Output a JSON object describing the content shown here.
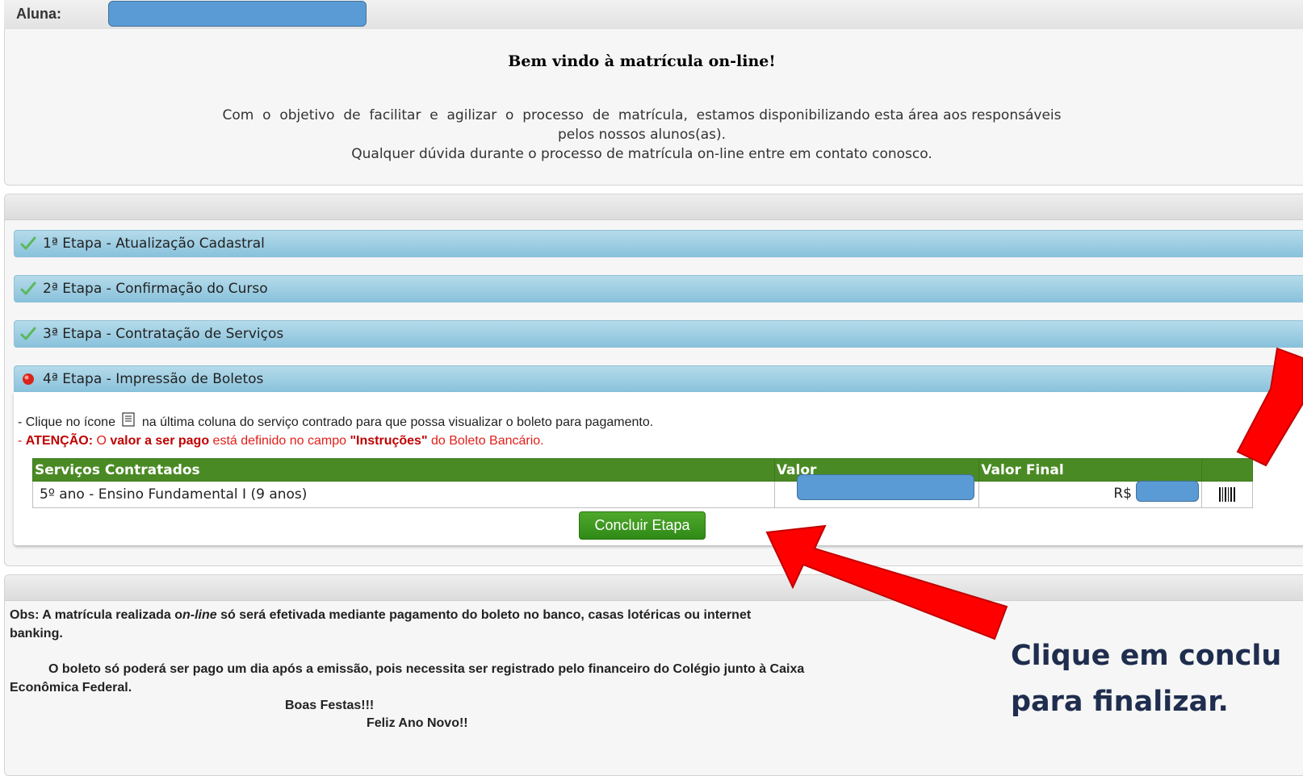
{
  "aluna": {
    "label": "Aluna:",
    "value": ""
  },
  "welcome": {
    "title": "Bem vindo à matrícula on-line!",
    "line1": "Com  o  objetivo  de  facilitar  e  agilizar  o  processo  de  matrícula,  estamos disponibilizando esta área aos responsáveis",
    "line2": "pelos nossos alunos(as).",
    "line3": "Qualquer dúvida durante o processo de matrícula on-line entre em contato conosco."
  },
  "steps": [
    {
      "label": "1ª Etapa - Atualização Cadastral",
      "status": "done",
      "icon": "check-icon"
    },
    {
      "label": "2ª Etapa - Confirmação do Curso",
      "status": "done",
      "icon": "check-icon"
    },
    {
      "label": "3ª Etapa - Contratação de Serviços",
      "status": "done",
      "icon": "check-icon"
    },
    {
      "label": "4ª Etapa - Impressão de Boletos",
      "status": "current",
      "icon": "red-dot-icon"
    }
  ],
  "step4": {
    "instruction_pre": "- Clique no ícone",
    "instruction_post": "na última coluna do serviço contrado para que possa visualizar o boleto para pagamento.",
    "attention_prefix": "- ",
    "attention_label": "ATENÇÃO:",
    "attention_text1": " O ",
    "attention_bold1": "valor a ser pago",
    "attention_text2": " está definido no campo ",
    "attention_bold2": "\"Instruções\"",
    "attention_text3": " do Boleto Bancário.",
    "table": {
      "headers": [
        "Serviços Contratados",
        "Valor",
        "Valor Final",
        ""
      ],
      "rows": [
        {
          "service": "5º ano - Ensino Fundamental I (9 anos)",
          "valor": "",
          "currency": "R$",
          "valor_final": "",
          "action_icon": "barcode-icon"
        }
      ]
    },
    "button_label": "Concluir Etapa"
  },
  "obs": {
    "line1_pre": "Obs: A matrícula realizada o",
    "line1_italic": "n-line",
    "line1_post": " só será efetivada mediante pagamento do boleto no banco, casas lotéricas ou internet",
    "line2": "banking.",
    "line3": "O boleto só poderá ser pago um dia após a emissão, pois necessita ser registrado pelo financeiro do Colégio junto à Caixa",
    "line4": "Econômica Federal.",
    "line5": "Boas Festas!!!",
    "line6": "Feliz Ano Novo!!"
  },
  "callout": {
    "line1": "Clique em conclu",
    "line2": "para finalizar."
  },
  "colors": {
    "step_bar": "#89c2dc",
    "table_header": "#4a8a24",
    "button": "#2f8a17",
    "arrow": "#ff0000",
    "redaction": "#5b9bd5",
    "callout_text": "#1f2d4e"
  }
}
